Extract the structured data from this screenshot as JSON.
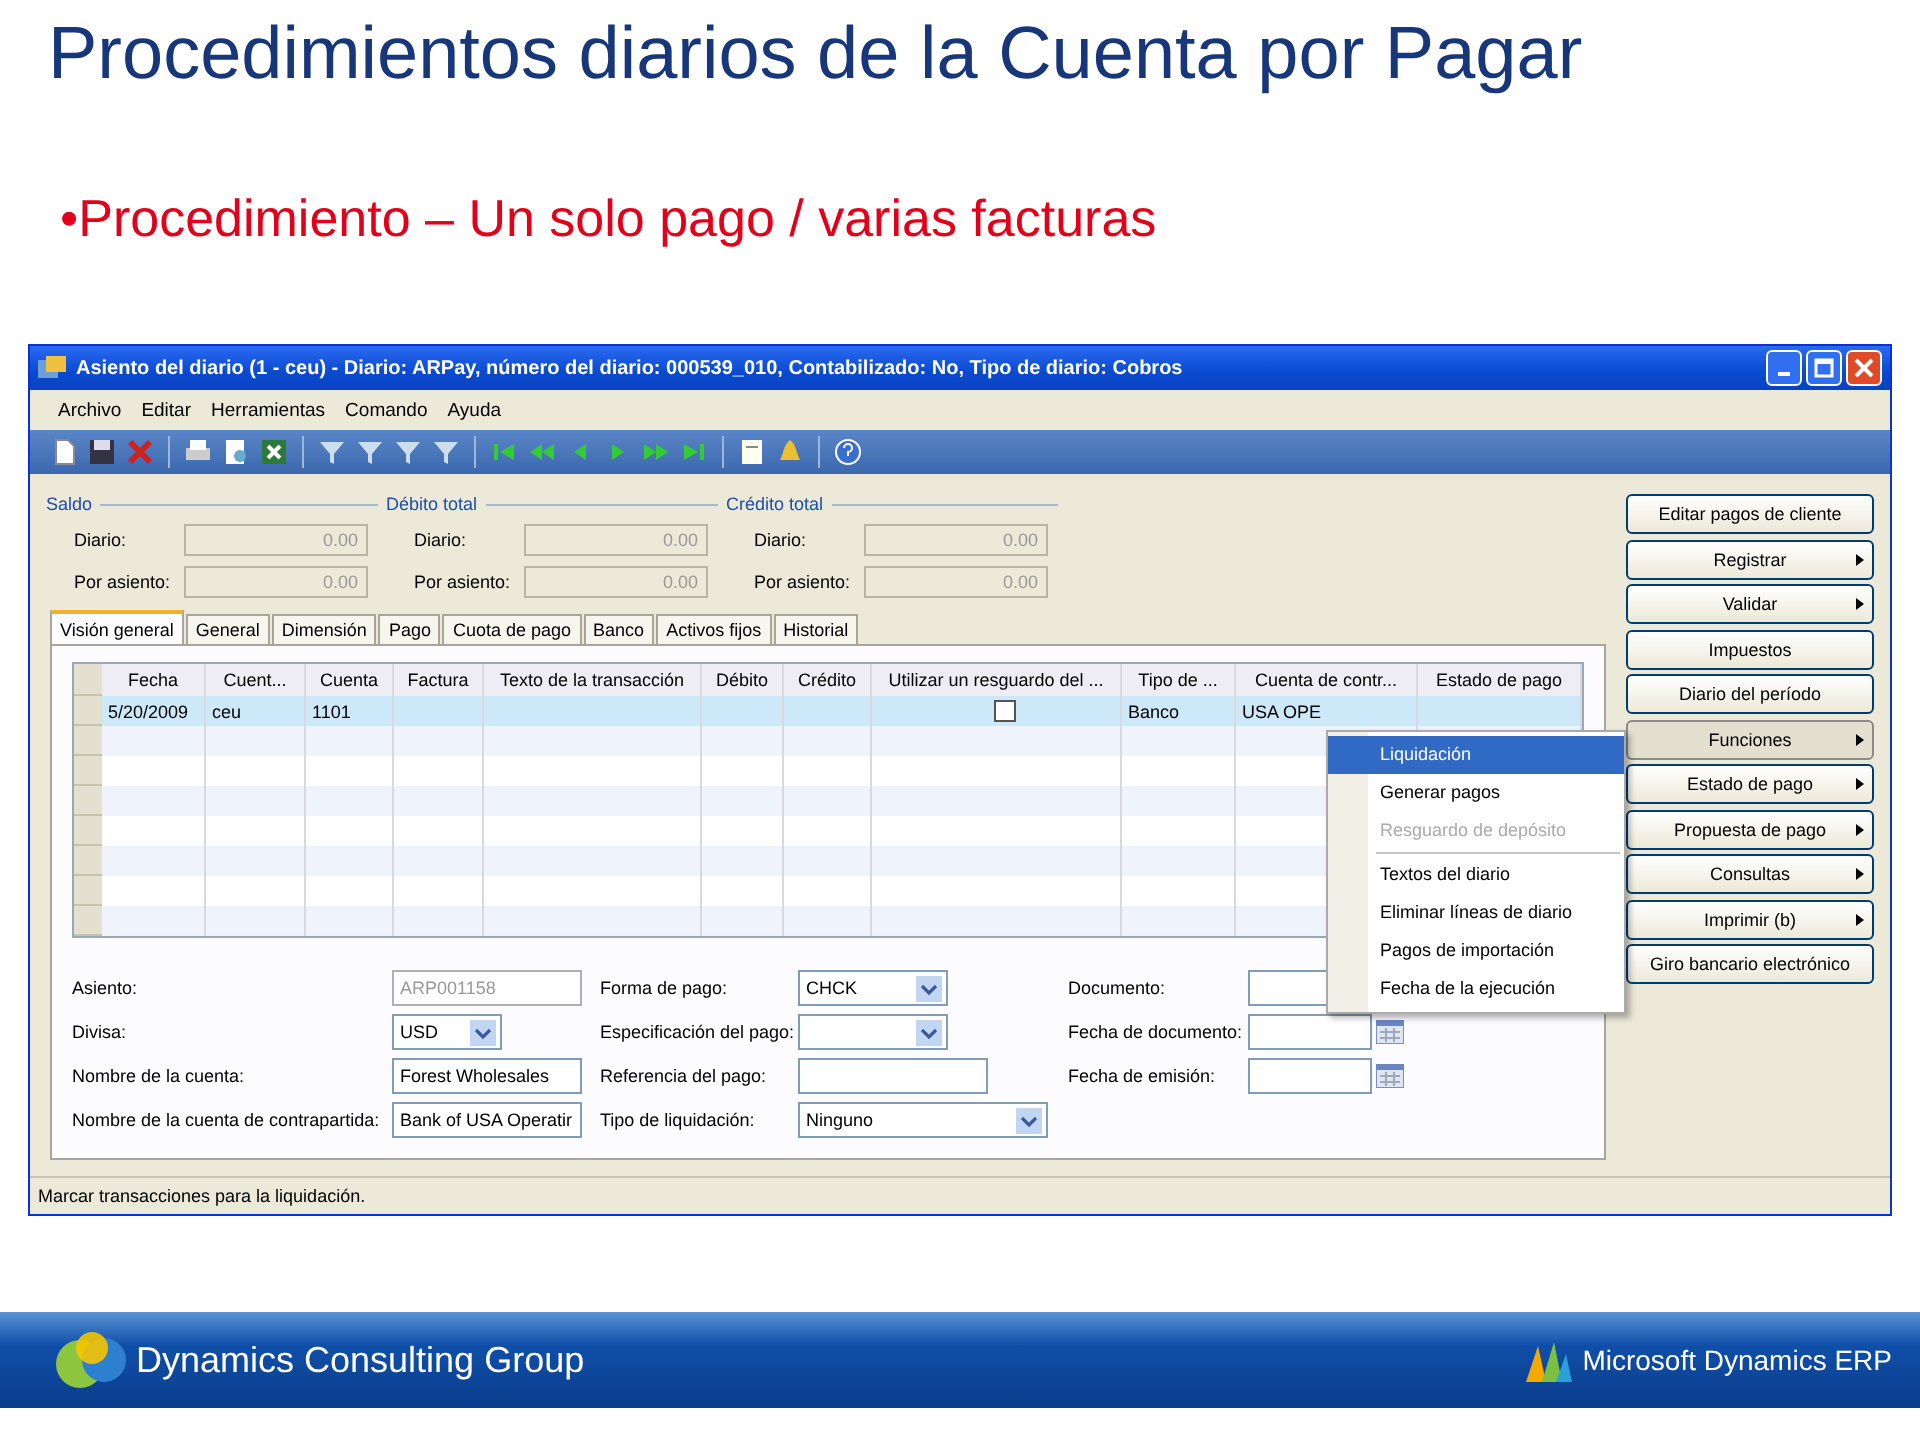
{
  "slide": {
    "title": "Procedimientos diarios de la Cuenta por Pagar",
    "bullet": "•Procedimiento – Un solo pago / varias facturas"
  },
  "window": {
    "title": "Asiento del diario (1 - ceu) - Diario: ARPay, número del diario: 000539_010, Contabilizado: No, Tipo de diario: Cobros",
    "menu": [
      "Archivo",
      "Editar",
      "Herramientas",
      "Comando",
      "Ayuda"
    ],
    "totals": [
      {
        "heading": "Saldo",
        "rows": [
          {
            "label": "Diario:",
            "value": "0.00"
          },
          {
            "label": "Por asiento:",
            "value": "0.00"
          }
        ]
      },
      {
        "heading": "Débito total",
        "rows": [
          {
            "label": "Diario:",
            "value": "0.00"
          },
          {
            "label": "Por asiento:",
            "value": "0.00"
          }
        ]
      },
      {
        "heading": "Crédito total",
        "rows": [
          {
            "label": "Diario:",
            "value": "0.00"
          },
          {
            "label": "Por asiento:",
            "value": "0.00"
          }
        ]
      }
    ],
    "tabs": [
      {
        "label": "Visión general",
        "selected": true
      },
      {
        "label": "General",
        "selected": false
      },
      {
        "label": "Dimensión",
        "selected": false
      },
      {
        "label": "Pago",
        "selected": false
      },
      {
        "label": "Cuota de pago",
        "selected": false
      },
      {
        "label": "Banco",
        "selected": false
      },
      {
        "label": "Activos fijos",
        "selected": false
      },
      {
        "label": "Historial",
        "selected": false
      }
    ],
    "grid": {
      "columns": [
        {
          "label": "Fecha",
          "kind": "text"
        },
        {
          "label": "Cuent...",
          "kind": "text"
        },
        {
          "label": "Cuenta",
          "kind": "text"
        },
        {
          "label": "Factura",
          "kind": "text"
        },
        {
          "label": "Texto de la transacción",
          "kind": "text"
        },
        {
          "label": "Débito",
          "kind": "text"
        },
        {
          "label": "Crédito",
          "kind": "text"
        },
        {
          "label": "Utilizar un resguardo del ...",
          "kind": "check"
        },
        {
          "label": "Tipo de ...",
          "kind": "text"
        },
        {
          "label": "Cuenta de contr...",
          "kind": "text"
        },
        {
          "label": "Estado de pago",
          "kind": "text"
        }
      ],
      "rows": [
        {
          "selected": true,
          "cells": [
            {
              "text": "5/20/2009"
            },
            {
              "text": "ceu"
            },
            {
              "text": "1101"
            },
            {},
            {},
            {},
            {},
            {
              "checked": false
            },
            {
              "text": "Banco"
            },
            {
              "text": "USA OPE"
            },
            {}
          ]
        }
      ]
    },
    "form": [
      [
        {
          "label": "Asiento:",
          "kind": "text",
          "value": "ARP001158",
          "disabled": true
        },
        {
          "label": "Divisa:",
          "kind": "combo",
          "value": "USD",
          "disabled": false
        },
        {
          "label": "Nombre de la cuenta:",
          "kind": "text",
          "value": "Forest Wholesales",
          "disabled": false
        },
        {
          "label": "Nombre de la cuenta de contrapartida:",
          "kind": "text",
          "value": "Bank of USA Operatir",
          "disabled": false
        }
      ],
      [
        {
          "label": "Forma de pago:",
          "kind": "combo",
          "value": "CHCK",
          "disabled": false
        },
        {
          "label": "Especificación del pago:",
          "kind": "combo",
          "disabled": false
        },
        {
          "label": "Referencia del pago:",
          "kind": "text",
          "disabled": false
        },
        {
          "label": "Tipo de liquidación:",
          "kind": "combo",
          "value": "Ninguno",
          "disabled": false
        }
      ],
      [
        {
          "label": "Documento:",
          "kind": "text",
          "disabled": false
        },
        {
          "label": "Fecha de documento:",
          "kind": "date",
          "disabled": false
        },
        {
          "label": "Fecha de emisión:",
          "kind": "date",
          "disabled": false
        }
      ]
    ],
    "buttons": [
      {
        "label": "Editar pagos de cliente",
        "submenu": false,
        "pressed": false
      },
      {
        "label": "Registrar",
        "submenu": true,
        "pressed": false
      },
      {
        "label": "Validar",
        "submenu": true,
        "pressed": false
      },
      {
        "label": "Impuestos",
        "submenu": false,
        "pressed": false
      },
      {
        "label": "Diario del período",
        "submenu": false,
        "pressed": false
      },
      {
        "label": "Funciones",
        "submenu": true,
        "pressed": true
      },
      {
        "label": "Estado de pago",
        "submenu": true,
        "pressed": false
      },
      {
        "label": "Propuesta de pago",
        "submenu": true,
        "pressed": false
      },
      {
        "label": "Consultas",
        "submenu": true,
        "pressed": false
      },
      {
        "label": "Imprimir (b)",
        "submenu": true,
        "pressed": false
      },
      {
        "label": "Giro bancario electrónico",
        "submenu": false,
        "pressed": false
      }
    ],
    "context_menu": [
      {
        "label": "Liquidación",
        "selected": true,
        "disabled": false,
        "separator_before": false
      },
      {
        "label": "Generar pagos",
        "selected": false,
        "disabled": false,
        "separator_before": false
      },
      {
        "label": "Resguardo de depósito",
        "selected": false,
        "disabled": true,
        "separator_before": false
      },
      {
        "label": "Textos del diario",
        "selected": false,
        "disabled": false,
        "separator_before": true
      },
      {
        "label": "Eliminar líneas de diario",
        "selected": false,
        "disabled": false,
        "separator_before": false
      },
      {
        "label": "Pagos de importación",
        "selected": false,
        "disabled": false,
        "separator_before": false
      },
      {
        "label": "Fecha de la ejecución",
        "selected": false,
        "disabled": false,
        "separator_before": false
      }
    ],
    "status_bar": "Marcar transacciones para la liquidación."
  },
  "footer": {
    "company": "Dynamics Consulting Group",
    "product": "Microsoft Dynamics ERP"
  }
}
